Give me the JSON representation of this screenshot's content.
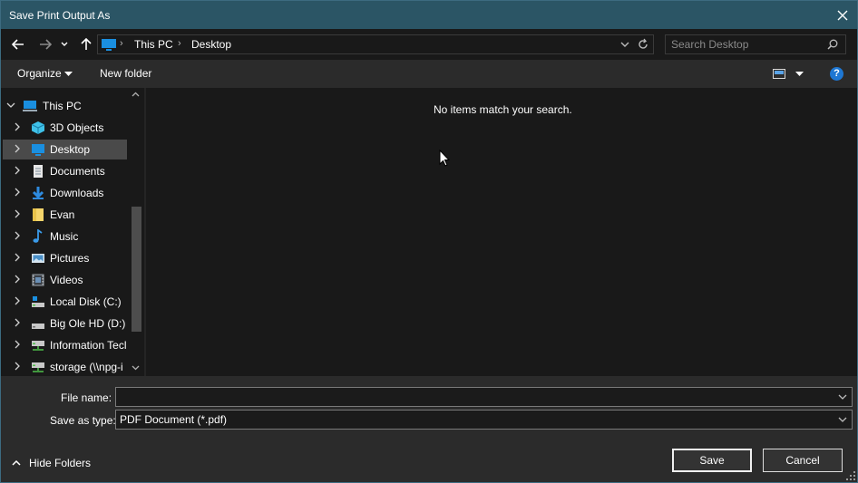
{
  "window": {
    "title": "Save Print Output As"
  },
  "nav": {
    "breadcrumb": [
      "This PC",
      "Desktop"
    ],
    "search_placeholder": "Search Desktop"
  },
  "commands": {
    "organize": "Organize",
    "new_folder": "New folder",
    "help": "?"
  },
  "tree": {
    "root": "This PC",
    "items": [
      {
        "label": "3D Objects",
        "icon": "cube-icon"
      },
      {
        "label": "Desktop",
        "icon": "desktop-icon",
        "selected": true
      },
      {
        "label": "Documents",
        "icon": "document-icon"
      },
      {
        "label": "Downloads",
        "icon": "download-icon"
      },
      {
        "label": "Evan",
        "icon": "folder-icon"
      },
      {
        "label": "Music",
        "icon": "music-icon"
      },
      {
        "label": "Pictures",
        "icon": "pictures-icon"
      },
      {
        "label": "Videos",
        "icon": "videos-icon"
      },
      {
        "label": "Local Disk (C:)",
        "icon": "local-disk-icon"
      },
      {
        "label": "Big Ole HD (D:)",
        "icon": "drive-icon"
      },
      {
        "label": "Information Tecl",
        "icon": "network-drive-icon"
      },
      {
        "label": "storage (\\\\npg-i",
        "icon": "network-drive-icon"
      }
    ]
  },
  "content": {
    "empty_message": "No items match your search."
  },
  "form": {
    "file_name_label": "File name:",
    "file_name_value": "",
    "save_as_type_label": "Save as type:",
    "save_as_type_value": "PDF Document (*.pdf)"
  },
  "footer": {
    "hide_folders": "Hide Folders",
    "save": "Save",
    "cancel": "Cancel"
  },
  "colors": {
    "titlebar": "#2b5565",
    "background": "#191919",
    "panel": "#2b2b2b",
    "accent": "#1e77d3"
  }
}
